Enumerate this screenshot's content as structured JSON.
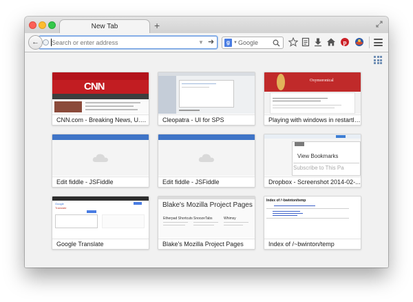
{
  "window": {
    "tab_title": "New Tab",
    "new_tab_symbol": "+"
  },
  "toolbar": {
    "url_placeholder": "Search or enter address",
    "url_value": "",
    "search_engine_letter": "g",
    "search_placeholder": "Google",
    "icons": [
      "star-icon",
      "reading-list-icon",
      "downloads-icon",
      "home-icon",
      "pinterest-icon",
      "sync-avatar-icon",
      "menu-icon"
    ]
  },
  "tiles": [
    {
      "title": "CNN.com - Breaking News, U.S., ...",
      "thumb": "cnn"
    },
    {
      "title": "Cleopatra - UI for SPS",
      "thumb": "cleopatra"
    },
    {
      "title": "Playing with windows in restartles...",
      "thumb": "blog"
    },
    {
      "title": "Edit fiddle - JSFiddle",
      "thumb": "jsfiddle"
    },
    {
      "title": "Edit fiddle - JSFiddle",
      "thumb": "jsfiddle"
    },
    {
      "title": "Dropbox - Screenshot 2014-02-...",
      "thumb": "dropbox"
    },
    {
      "title": "Google Translate",
      "thumb": "translate"
    },
    {
      "title": "Blake's Mozilla Project Pages",
      "thumb": "blake"
    },
    {
      "title": "Index of /~bwinton/temp",
      "thumb": "index"
    }
  ],
  "thumb_text": {
    "cnn_logo": "CNN",
    "blog_title": "Oxymoronical",
    "dropbox_menu": "View Bookmarks",
    "dropbox_sub": "Subscribe to This Pa",
    "blake_heading": "Blake's Mozilla Project Pages",
    "blake_cols": [
      "Etherpad Shortcuts",
      "SnoozeTabs",
      "Whimsy"
    ],
    "index_heading": "Index of /~bwinton/temp",
    "translate_brand": "Google",
    "translate_label": "Translate"
  },
  "colors": {
    "url_focus": "#6d9ce0",
    "cnn_red": "#c21d22",
    "jsfiddle_blue": "#3f74c7",
    "blog_red": "#c02a2a"
  }
}
